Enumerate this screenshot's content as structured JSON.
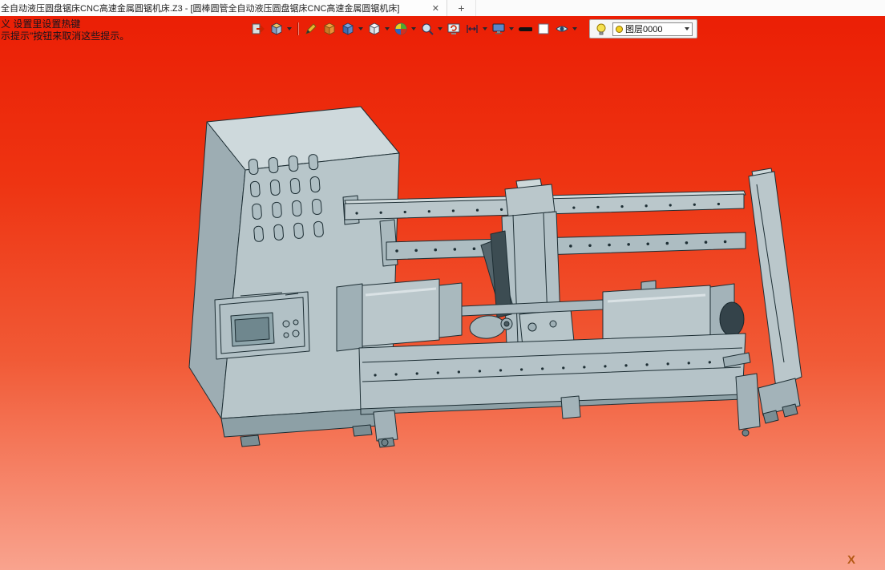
{
  "tabbar": {
    "title": "全自动液压圆盘锯床CNC高速金属圆锯机床.Z3 - [圆棒圆管全自动液压圆盘锯床CNC高速金属圆锯机床]",
    "close_glyph": "✕",
    "new_tab_glyph": "+"
  },
  "hints": {
    "line1": "义 设置里设置热键",
    "line2": "示提示\"按钮来取消这些提示。"
  },
  "toolbar": {
    "icons": [
      "exit-icon",
      "view-cube-icon",
      "pencil-icon",
      "shaded-cube-icon",
      "blue-cube-icon",
      "white-cube-icon",
      "color-wheel-icon",
      "zoom-icon",
      "screen-refresh-icon",
      "fit-window-icon",
      "monitor-icon",
      "line-width-icon",
      "background-color-icon",
      "eye-icon",
      "lightbulb-icon"
    ],
    "layer": {
      "value": "图层0000"
    }
  },
  "viewport": {
    "axis_label": "X",
    "bg_top": "#eb1f05",
    "bg_bottom": "#f9a38e",
    "model_color": "#b8c6ca"
  }
}
